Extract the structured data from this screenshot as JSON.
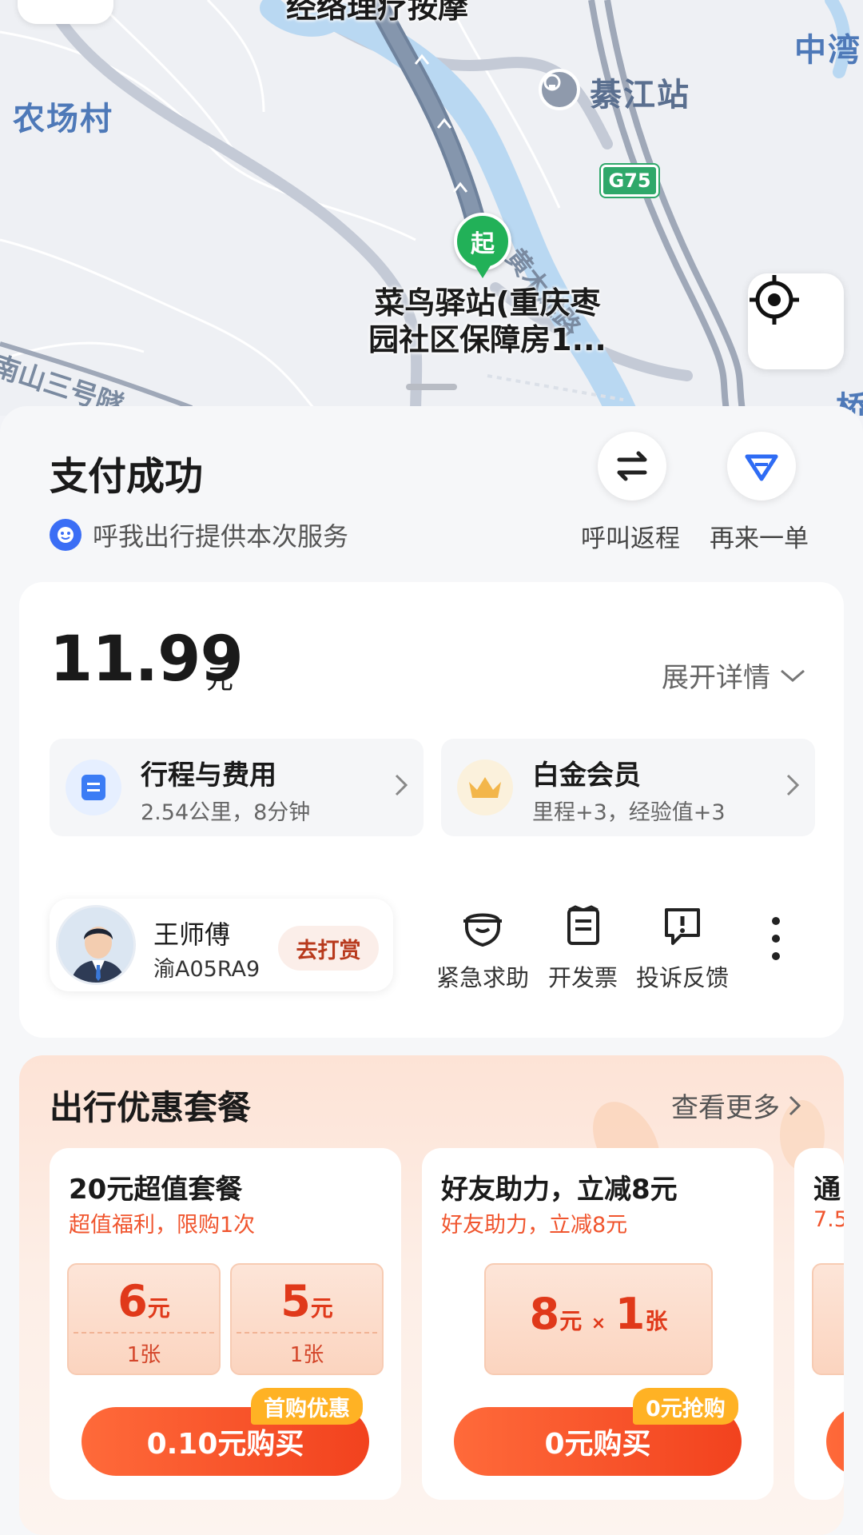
{
  "map": {
    "labels": {
      "village": "农场村",
      "massage": "经络理疗按摩",
      "station": "綦江站",
      "zhongwan": "中湾",
      "highway": "G75",
      "road_huangmu": "黄木滩路",
      "road_nanshan": "南山三号隧",
      "bridge": "桥",
      "pickup": "菜鸟驿站(重庆枣园社区保障房1...",
      "pin": "起"
    }
  },
  "status": {
    "title": "支付成功",
    "service_text": "呼我出行提供本次服务",
    "return_label": "呼叫返程",
    "reorder_label": "再来一单"
  },
  "fare": {
    "amount": "11.99",
    "unit": "元",
    "expand_label": "展开详情",
    "trip_title": "行程与费用",
    "trip_sub": "2.54公里，8分钟",
    "member_title": "白金会员",
    "member_sub": "里程+3，经验值+3"
  },
  "driver": {
    "name": "王师傅",
    "plate": "渝A05RA9",
    "tip_label": "去打赏"
  },
  "actions": {
    "sos": "紧急求助",
    "invoice": "开发票",
    "complaint": "投诉反馈"
  },
  "promo": {
    "title": "出行优惠套餐",
    "more": "查看更多",
    "packages": [
      {
        "title": "20元超值套餐",
        "subtitle": "超值福利，限购1次",
        "coupons": [
          {
            "value": "6",
            "unit": "元",
            "count": "1张"
          },
          {
            "value": "5",
            "unit": "元",
            "count": "1张"
          }
        ],
        "button": "0.10元购买",
        "tag": "首购优惠"
      },
      {
        "title": "好友助力，立减8元",
        "subtitle": "好友助力，立减8元",
        "coupon_value": "8",
        "coupon_unit": "元",
        "coupon_x": "×",
        "coupon_qty": "1",
        "coupon_qty_unit": "张",
        "button": "0元购买",
        "tag": "0元抢购"
      },
      {
        "title": "通",
        "subtitle": "7.5"
      }
    ]
  },
  "colors": {
    "accent": "#f2421e",
    "brand_blue": "#3b6ef5",
    "pin_green": "#22b158",
    "tag_orange": "#ffb224"
  }
}
